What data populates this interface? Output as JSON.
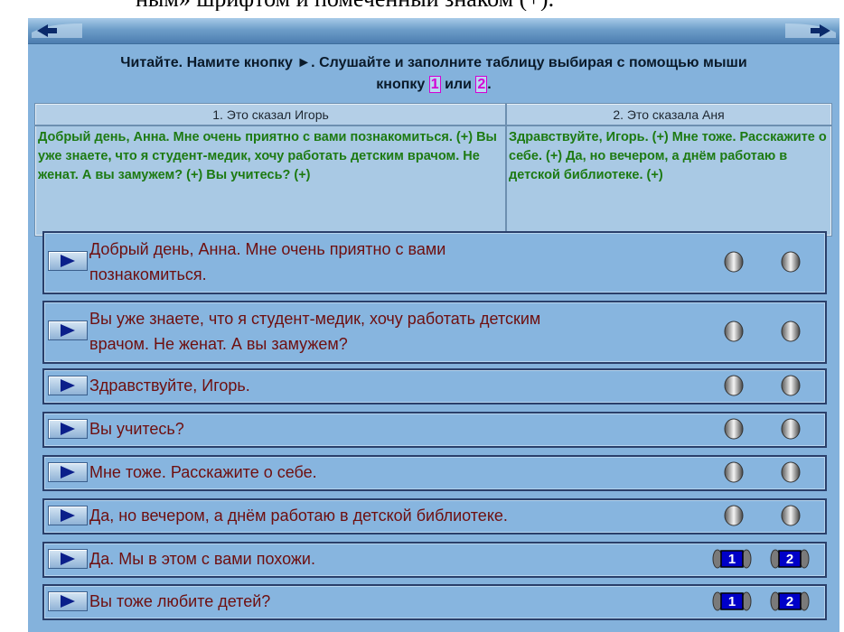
{
  "page": {
    "heading_fragment": "ным» шрифтом и помеченный знаком (+)."
  },
  "nav": {
    "left_icon": "arrow-left-icon",
    "right_icon": "arrow-right-icon"
  },
  "instructions": {
    "line1": "Читайте. Намите кнопку ►. Слушайте и заполните таблицу выбирая с помощью мыши",
    "line2_before": "кнопку ",
    "num1": "1",
    "mid": " или ",
    "num2": "2",
    "after": "."
  },
  "table": {
    "headers": [
      "1. Это сказал Игорь",
      "2. Это сказала Аня"
    ],
    "col1_text": "Добрый день, Анна. Мне очень приятно с вами познакомиться. (+) Вы уже знаете, что я студент-медик, хочу работать детским врачом. Не женат. А вы замужем? (+) Вы учитесь? (+)",
    "col2_text": "Здравствуйте, Игорь. (+) Мне тоже. Расскажите о себе. (+) Да, но вечером, а днём работаю в детской библиотеке. (+)"
  },
  "rows": [
    {
      "line1": "Добрый день, Анна. Мне очень приятно с вами",
      "line2": "познакомиться."
    },
    {
      "line1": "Вы уже знаете, что я студент-медик, хочу работать детским",
      "line2": "врачом. Не женат. А вы замужем?"
    },
    {
      "line1": "Здравствуйте, Игорь."
    },
    {
      "line1": "Вы учитесь?"
    },
    {
      "line1": "Мне тоже. Расскажите о себе."
    },
    {
      "line1": "Да, но вечером, а днём работаю в детской библиотеке."
    },
    {
      "line1": "Да. Мы в этом с вами похожи.",
      "btn1": "1",
      "btn2": "2"
    },
    {
      "line1": "Вы тоже любите детей?",
      "btn1": "1",
      "btn2": "2"
    }
  ],
  "colors": {
    "background": "#84b2dc",
    "phrase_text": "#6e0f0f",
    "table_text": "#1d7a12",
    "number_box": "#d400d4"
  }
}
